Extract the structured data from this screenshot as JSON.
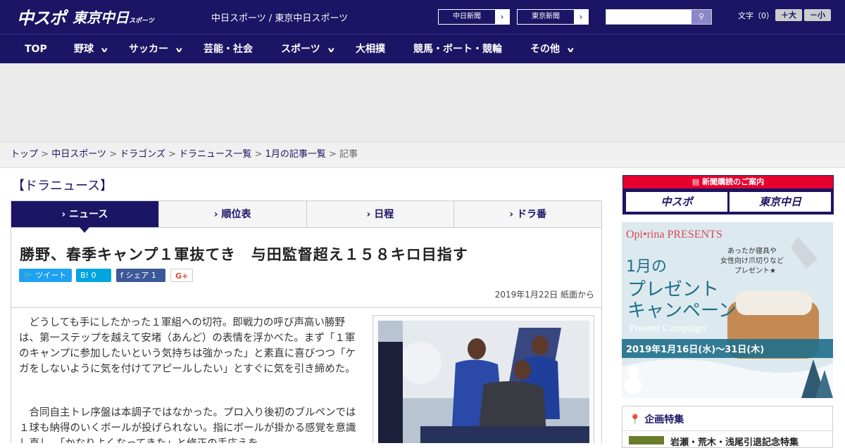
{
  "header": {
    "logo_main": "中スポ",
    "logo_sub": "東京中日",
    "logo_sub_small": "スポーツ",
    "site_name": "中日スポーツ / 東京中日スポーツ",
    "link1": "中日新聞",
    "link2": "東京新聞",
    "font_label": "文字（0）",
    "font_plus": "＋大",
    "font_minus": "－小"
  },
  "nav": [
    "TOP",
    "野球",
    "サッカー",
    "芸能・社会",
    "スポーツ",
    "大相撲",
    "競馬・ボート・競輪",
    "その他"
  ],
  "breadcrumb": {
    "items": [
      "トップ",
      "中日スポーツ",
      "ドラゴンズ",
      "ドラニュース一覧",
      "1月の記事一覧"
    ],
    "current": "記事"
  },
  "section_title": "【ドラニュース】",
  "tabs": [
    "ニュース",
    "順位表",
    "日程",
    "ドラ番"
  ],
  "article": {
    "headline": "勝野、春季キャンプ１軍抜てき　与田監督超え１５８キロ目指す",
    "share": {
      "tweet": "ツイート",
      "hatena": "B!",
      "hatena_count": "0",
      "fb": "シェア",
      "fb_count": "1",
      "gplus": "G+"
    },
    "date": "2019年1月22日 紙面から",
    "p1": "どうしても手にしたかった１軍組への切符。即戦力の呼び声高い勝野は、第一ステップを越えて安堵（あんど）の表情を浮かべた。まず「１軍のキャンプに参加したいという気持ちは強かった」と素直に喜びつつ「ケガをしないように気を付けてアピールしたい」とすぐに気を引き締めた。",
    "p2": "合同自主トレ序盤は本調子ではなかった。プロ入り後初のブルペンでは１球も納得のいくボールが投げられない。指にボールが掛かる感覚を意識し直し、「かなりよくなってきた」と修正の手応えを"
  },
  "sidebar": {
    "subscribe": "新聞購読のご案内",
    "box1": "中スポ",
    "box2": "東京中日",
    "ad_brand": "Opi•rina PRESENTS",
    "ad_copy": "あったか寝具や 女性向け爪切りなど プレゼント★",
    "ad_title1": "1月の",
    "ad_title2": "プレゼント",
    "ad_title3": "キャンペーン",
    "ad_en": "Present Campaign",
    "ad_dates": "2019年1月16日(水)〜31日(木)",
    "feature_title": "企画特集",
    "feature_item": "岩瀬・荒木・浅尾引退記念特集"
  }
}
